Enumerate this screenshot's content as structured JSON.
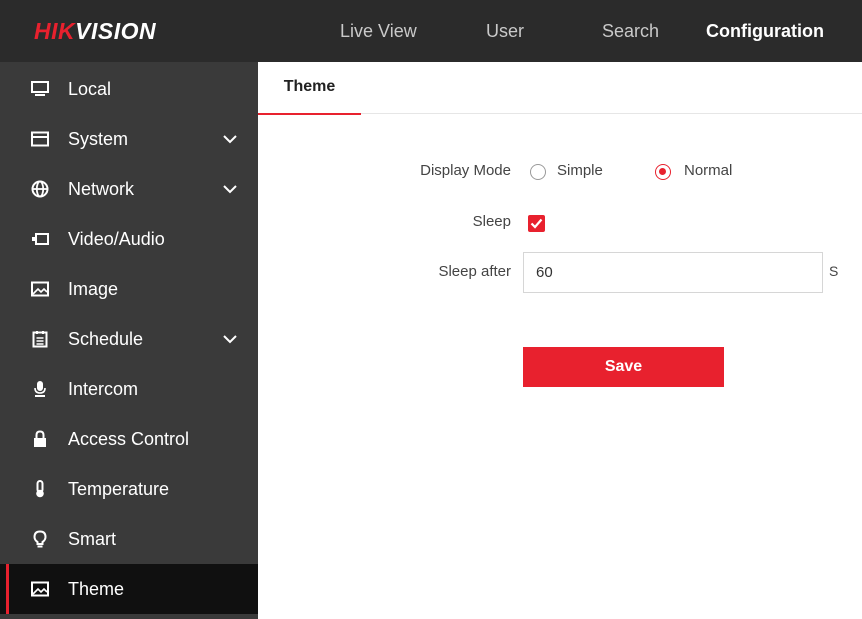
{
  "header": {
    "logo_part1": "HIK",
    "logo_part2": "VISION",
    "nav": [
      {
        "label": "Live View"
      },
      {
        "label": "User"
      },
      {
        "label": "Search"
      },
      {
        "label": "Configuration",
        "active": true
      }
    ]
  },
  "sidebar": {
    "items": [
      {
        "label": "Local",
        "icon": "monitor-icon"
      },
      {
        "label": "System",
        "icon": "window-icon",
        "expandable": true
      },
      {
        "label": "Network",
        "icon": "globe-icon",
        "expandable": true
      },
      {
        "label": "Video/Audio",
        "icon": "video-icon"
      },
      {
        "label": "Image",
        "icon": "image-icon"
      },
      {
        "label": "Schedule",
        "icon": "calendar-icon",
        "expandable": true
      },
      {
        "label": "Intercom",
        "icon": "microphone-icon"
      },
      {
        "label": "Access Control",
        "icon": "lock-icon"
      },
      {
        "label": "Temperature",
        "icon": "thermometer-icon"
      },
      {
        "label": "Smart",
        "icon": "bulb-icon"
      },
      {
        "label": "Theme",
        "icon": "image-icon",
        "active": true
      }
    ]
  },
  "main": {
    "tab": "Theme",
    "display_mode": {
      "label": "Display Mode",
      "options": [
        "Simple",
        "Normal"
      ],
      "selected": "Normal"
    },
    "sleep": {
      "label": "Sleep",
      "checked": true
    },
    "sleep_after": {
      "label": "Sleep after",
      "value": "60",
      "unit": "S"
    },
    "save_label": "Save"
  },
  "colors": {
    "accent": "#e8212e",
    "topbar": "#2b2b2b",
    "sidebar": "#3a3a3a",
    "sidebar_active": "#101010"
  }
}
